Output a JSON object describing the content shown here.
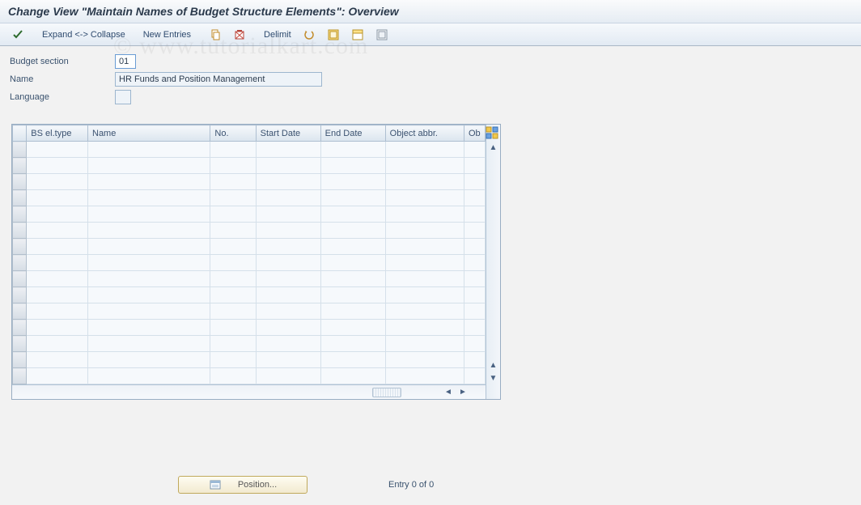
{
  "title": "Change View \"Maintain Names of Budget Structure Elements\": Overview",
  "toolbar": {
    "expand_collapse": "Expand <-> Collapse",
    "new_entries": "New Entries",
    "delimit": "Delimit"
  },
  "form": {
    "budget_section_label": "Budget section",
    "budget_section_value": "01",
    "name_label": "Name",
    "name_value": "HR Funds and Position Management",
    "language_label": "Language",
    "language_value": ""
  },
  "table": {
    "columns": {
      "bs_el_type": "BS el.type",
      "name": "Name",
      "no": "No.",
      "start_date": "Start Date",
      "end_date": "End Date",
      "object_abbr": "Object abbr.",
      "ob": "Ob"
    },
    "row_count": 15
  },
  "footer": {
    "position_label": "Position...",
    "entry_text": "Entry 0 of 0"
  },
  "watermark_text": "© www.tutorialkart.com"
}
